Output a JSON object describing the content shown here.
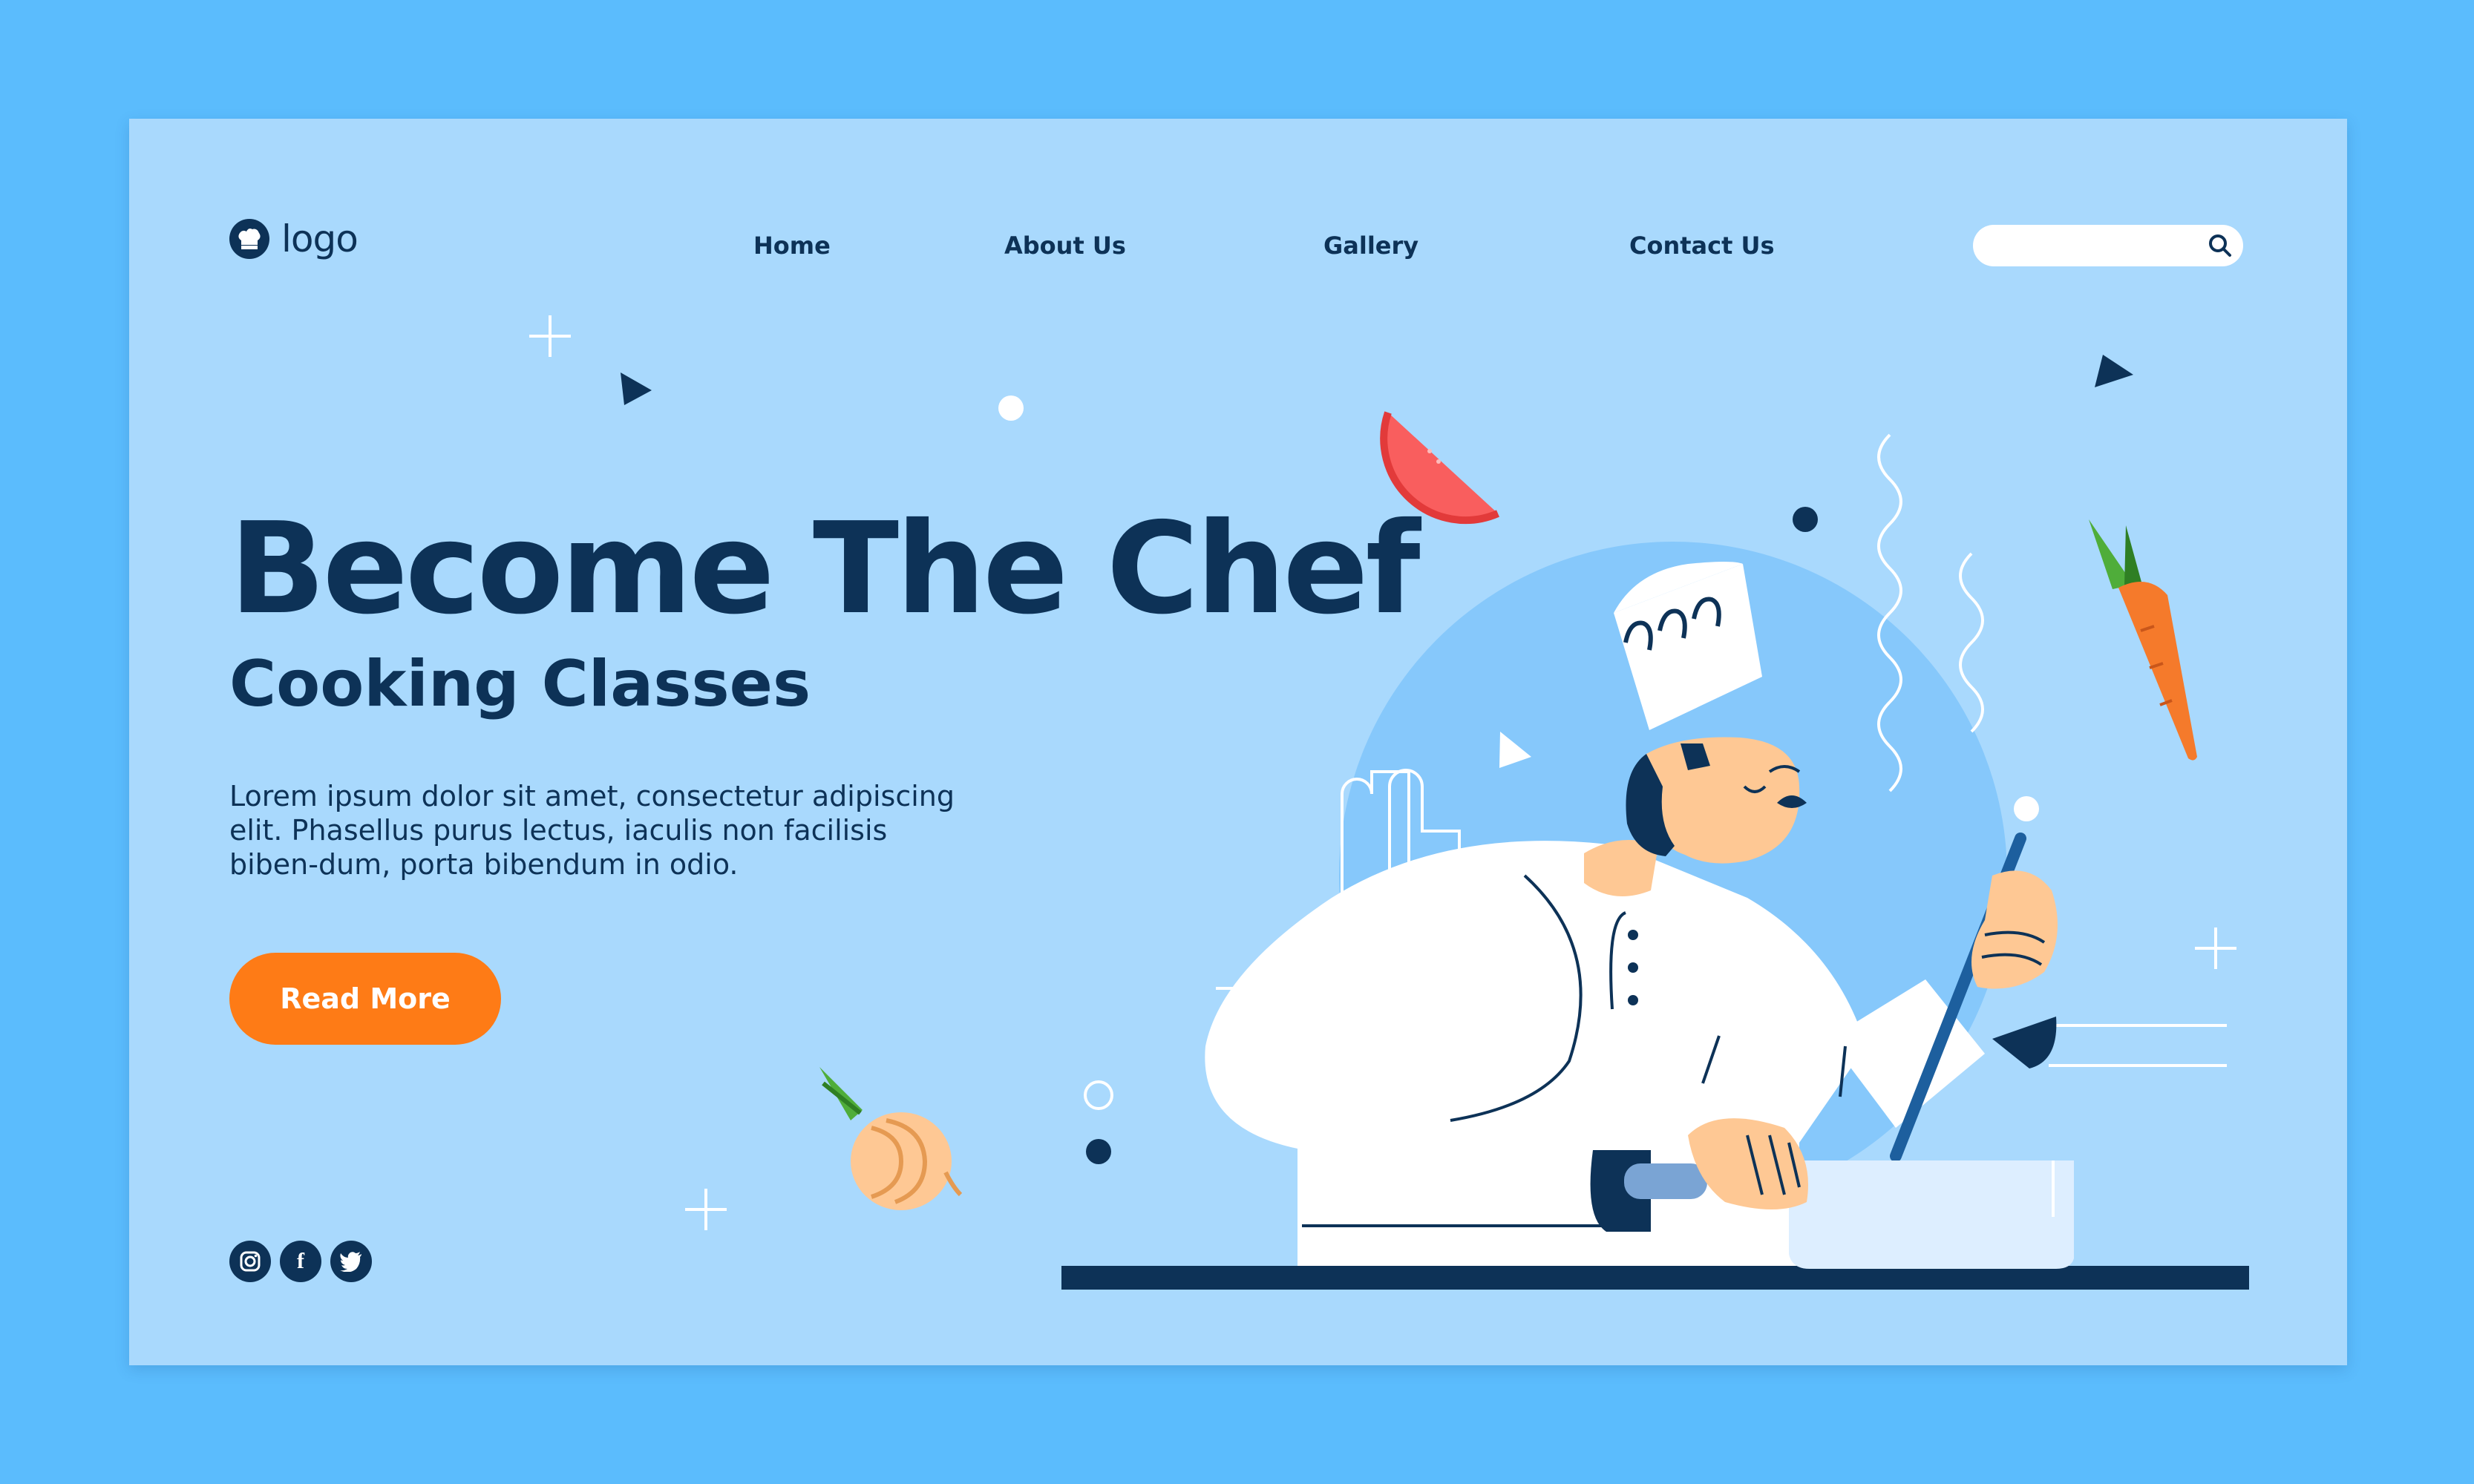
{
  "logo": {
    "text": "logo",
    "icon": "chef-hat-icon"
  },
  "nav": {
    "items": [
      {
        "label": "Home"
      },
      {
        "label": "About Us"
      },
      {
        "label": "Gallery"
      },
      {
        "label": "Contact Us"
      }
    ]
  },
  "search": {
    "placeholder": "",
    "icon": "search-icon"
  },
  "hero": {
    "title": "Become The Chef",
    "subtitle": "Cooking Classes",
    "description": "Lorem ipsum dolor sit amet, consectetur adipiscing elit. Phasellus purus lectus, iaculis non facilisis biben-dum, porta bibendum in odio.",
    "cta_label": "Read More"
  },
  "social": [
    {
      "icon": "instagram-icon"
    },
    {
      "icon": "facebook-icon",
      "glyph": "f"
    },
    {
      "icon": "twitter-icon"
    }
  ],
  "colors": {
    "page_bg": "#5bbcfd",
    "card_bg": "#a9d9fd",
    "primary": "#0d3257",
    "accent": "#fe7b16",
    "illustration_circle": "#86c8fb",
    "skin": "#fec894",
    "tomato": "#f95e5e",
    "carrot": "#f57a2b",
    "leaf": "#4fad3a"
  }
}
